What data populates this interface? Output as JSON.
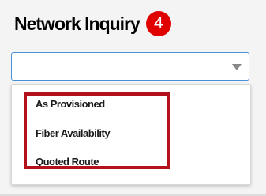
{
  "header": {
    "title": "Network Inquiry",
    "step_number": "4"
  },
  "dropdown": {
    "selected_value": "",
    "options": [
      "As Provisioned",
      "Fiber Availability",
      "Quoted Route"
    ]
  },
  "colors": {
    "badge": "#e00000",
    "highlight": "#b3121a",
    "select_border": "#4a90d9"
  }
}
